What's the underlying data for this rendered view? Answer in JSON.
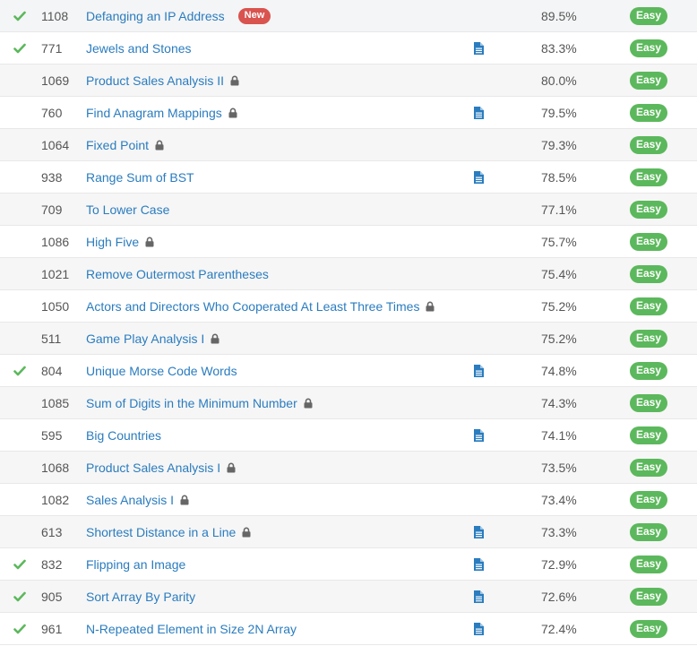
{
  "colors": {
    "link": "#2a7cbf",
    "check": "#5cb85c",
    "easy_badge": "#5cb85c",
    "new_badge": "#d9534f",
    "solution_icon": "#2a7cbf",
    "lock_icon": "#666666"
  },
  "problems": [
    {
      "solved": true,
      "id": "1108",
      "title": "Defanging an IP Address",
      "locked": false,
      "new_label": "New",
      "solution": false,
      "acceptance": "89.5%",
      "difficulty": "Easy"
    },
    {
      "solved": true,
      "id": "771",
      "title": "Jewels and Stones",
      "locked": false,
      "new_label": "",
      "solution": true,
      "acceptance": "83.3%",
      "difficulty": "Easy"
    },
    {
      "solved": false,
      "id": "1069",
      "title": "Product Sales Analysis II",
      "locked": true,
      "new_label": "",
      "solution": false,
      "acceptance": "80.0%",
      "difficulty": "Easy"
    },
    {
      "solved": false,
      "id": "760",
      "title": "Find Anagram Mappings",
      "locked": true,
      "new_label": "",
      "solution": true,
      "acceptance": "79.5%",
      "difficulty": "Easy"
    },
    {
      "solved": false,
      "id": "1064",
      "title": "Fixed Point",
      "locked": true,
      "new_label": "",
      "solution": false,
      "acceptance": "79.3%",
      "difficulty": "Easy"
    },
    {
      "solved": false,
      "id": "938",
      "title": "Range Sum of BST",
      "locked": false,
      "new_label": "",
      "solution": true,
      "acceptance": "78.5%",
      "difficulty": "Easy"
    },
    {
      "solved": false,
      "id": "709",
      "title": "To Lower Case",
      "locked": false,
      "new_label": "",
      "solution": false,
      "acceptance": "77.1%",
      "difficulty": "Easy"
    },
    {
      "solved": false,
      "id": "1086",
      "title": "High Five",
      "locked": true,
      "new_label": "",
      "solution": false,
      "acceptance": "75.7%",
      "difficulty": "Easy"
    },
    {
      "solved": false,
      "id": "1021",
      "title": "Remove Outermost Parentheses",
      "locked": false,
      "new_label": "",
      "solution": false,
      "acceptance": "75.4%",
      "difficulty": "Easy"
    },
    {
      "solved": false,
      "id": "1050",
      "title": "Actors and Directors Who Cooperated At Least Three Times",
      "locked": true,
      "new_label": "",
      "solution": false,
      "acceptance": "75.2%",
      "difficulty": "Easy"
    },
    {
      "solved": false,
      "id": "511",
      "title": "Game Play Analysis I",
      "locked": true,
      "new_label": "",
      "solution": false,
      "acceptance": "75.2%",
      "difficulty": "Easy"
    },
    {
      "solved": true,
      "id": "804",
      "title": "Unique Morse Code Words",
      "locked": false,
      "new_label": "",
      "solution": true,
      "acceptance": "74.8%",
      "difficulty": "Easy"
    },
    {
      "solved": false,
      "id": "1085",
      "title": "Sum of Digits in the Minimum Number",
      "locked": true,
      "new_label": "",
      "solution": false,
      "acceptance": "74.3%",
      "difficulty": "Easy"
    },
    {
      "solved": false,
      "id": "595",
      "title": "Big Countries",
      "locked": false,
      "new_label": "",
      "solution": true,
      "acceptance": "74.1%",
      "difficulty": "Easy"
    },
    {
      "solved": false,
      "id": "1068",
      "title": "Product Sales Analysis I",
      "locked": true,
      "new_label": "",
      "solution": false,
      "acceptance": "73.5%",
      "difficulty": "Easy"
    },
    {
      "solved": false,
      "id": "1082",
      "title": "Sales Analysis I",
      "locked": true,
      "new_label": "",
      "solution": false,
      "acceptance": "73.4%",
      "difficulty": "Easy"
    },
    {
      "solved": false,
      "id": "613",
      "title": "Shortest Distance in a Line",
      "locked": true,
      "new_label": "",
      "solution": true,
      "acceptance": "73.3%",
      "difficulty": "Easy"
    },
    {
      "solved": true,
      "id": "832",
      "title": "Flipping an Image",
      "locked": false,
      "new_label": "",
      "solution": true,
      "acceptance": "72.9%",
      "difficulty": "Easy"
    },
    {
      "solved": true,
      "id": "905",
      "title": "Sort Array By Parity",
      "locked": false,
      "new_label": "",
      "solution": true,
      "acceptance": "72.6%",
      "difficulty": "Easy"
    },
    {
      "solved": true,
      "id": "961",
      "title": "N-Repeated Element in Size 2N Array",
      "locked": false,
      "new_label": "",
      "solution": true,
      "acceptance": "72.4%",
      "difficulty": "Easy"
    }
  ]
}
